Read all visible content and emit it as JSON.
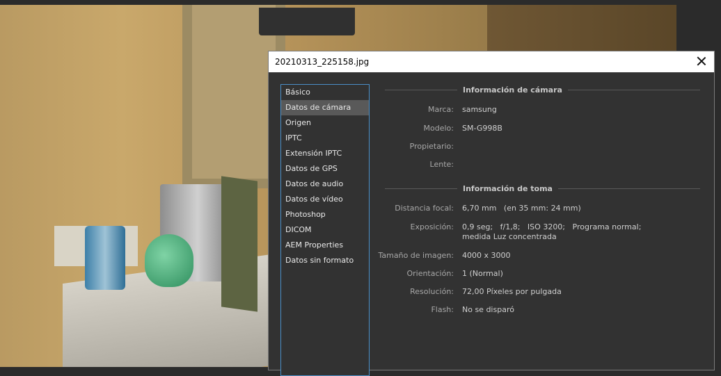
{
  "dialog": {
    "title": "20210313_225158.jpg",
    "categories": [
      {
        "label": "Básico"
      },
      {
        "label": "Datos de cámara",
        "selected": true
      },
      {
        "label": "Origen"
      },
      {
        "label": "IPTC"
      },
      {
        "label": "Extensión IPTC"
      },
      {
        "label": "Datos de GPS"
      },
      {
        "label": "Datos de audio"
      },
      {
        "label": "Datos de vídeo"
      },
      {
        "label": "Photoshop"
      },
      {
        "label": "DICOM"
      },
      {
        "label": "AEM Properties"
      },
      {
        "label": "Datos sin formato"
      }
    ],
    "camera_section": {
      "heading": "Información de cámara",
      "fields": [
        {
          "label": "Marca:",
          "value": "samsung"
        },
        {
          "label": "Modelo:",
          "value": "SM-G998B"
        },
        {
          "label": "Propietario:",
          "value": ""
        },
        {
          "label": "Lente:",
          "value": ""
        }
      ]
    },
    "shot_section": {
      "heading": "Información de toma",
      "fields": [
        {
          "label": "Distancia focal:",
          "value": "6,70 mm   (en 35 mm: 24 mm)"
        },
        {
          "label": "Exposición:",
          "value": "0,9 seg;   f/1,8;   ISO 3200;   Programa normal;   medida Luz concentrada"
        },
        {
          "label": "Tamaño de imagen:",
          "value": "4000 x 3000"
        },
        {
          "label": "Orientación:",
          "value": "1 (Normal)"
        },
        {
          "label": "Resolución:",
          "value": "72,00 Píxeles por pulgada"
        },
        {
          "label": "Flash:",
          "value": "No se disparó"
        }
      ]
    }
  },
  "icons": {
    "close": "close-icon"
  }
}
